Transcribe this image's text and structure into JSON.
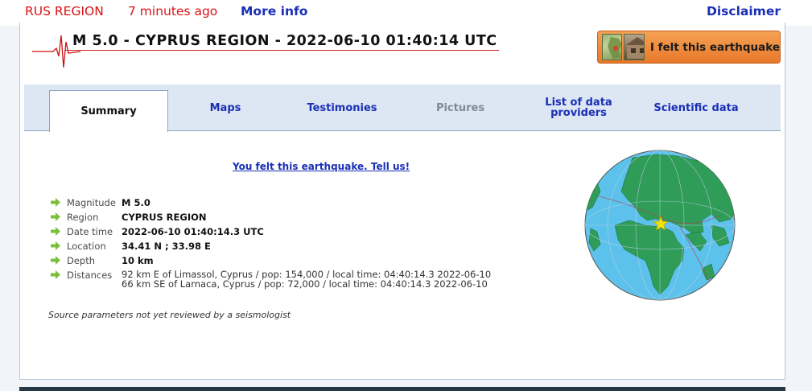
{
  "header": {
    "region": "RUS REGION",
    "time_ago": "7 minutes ago",
    "more_info": "More info",
    "disclaimer": "Disclaimer"
  },
  "event": {
    "title": "M 5.0 - CYPRUS REGION - 2022-06-10 01:40:14 UTC",
    "felt_button": "I felt this earthquake"
  },
  "tabs": [
    {
      "label": "Summary"
    },
    {
      "label": "Maps"
    },
    {
      "label": "Testimonies"
    },
    {
      "label": "Pictures"
    },
    {
      "label": "List of data providers"
    },
    {
      "label": "Scientific data"
    }
  ],
  "summary": {
    "tell_us": "You felt this earthquake. Tell us!",
    "rows": {
      "magnitude": {
        "label": "Magnitude",
        "value": "M 5.0"
      },
      "region": {
        "label": "Region",
        "value": "CYPRUS REGION"
      },
      "datetime": {
        "label": "Date time",
        "value": "2022-06-10 01:40:14.3 UTC"
      },
      "location": {
        "label": "Location",
        "value": "34.41 N ; 33.98 E"
      },
      "depth": {
        "label": "Depth",
        "value": "10 km"
      },
      "distances": {
        "label": "Distances",
        "line1": "92 km E of Limassol, Cyprus / pop: 154,000 / local time: 04:40:14.3 2022-06-10",
        "line2": "66 km SE of Larnaca, Cyprus / pop: 72,000 / local time: 04:40:14.3 2022-06-10"
      }
    },
    "source_note": "Source parameters not yet reviewed by a seismologist"
  },
  "colors": {
    "header_red": "#dd1111",
    "link_blue": "#1a2fb5",
    "button_orange": "#e8782a",
    "tab_bg": "#dde6f3",
    "arrow_green": "#7cbf3a"
  },
  "icons": {
    "seismogram": "seismogram-icon",
    "row_bullet": "green-arrow-icon",
    "epicenter": "star-icon"
  }
}
